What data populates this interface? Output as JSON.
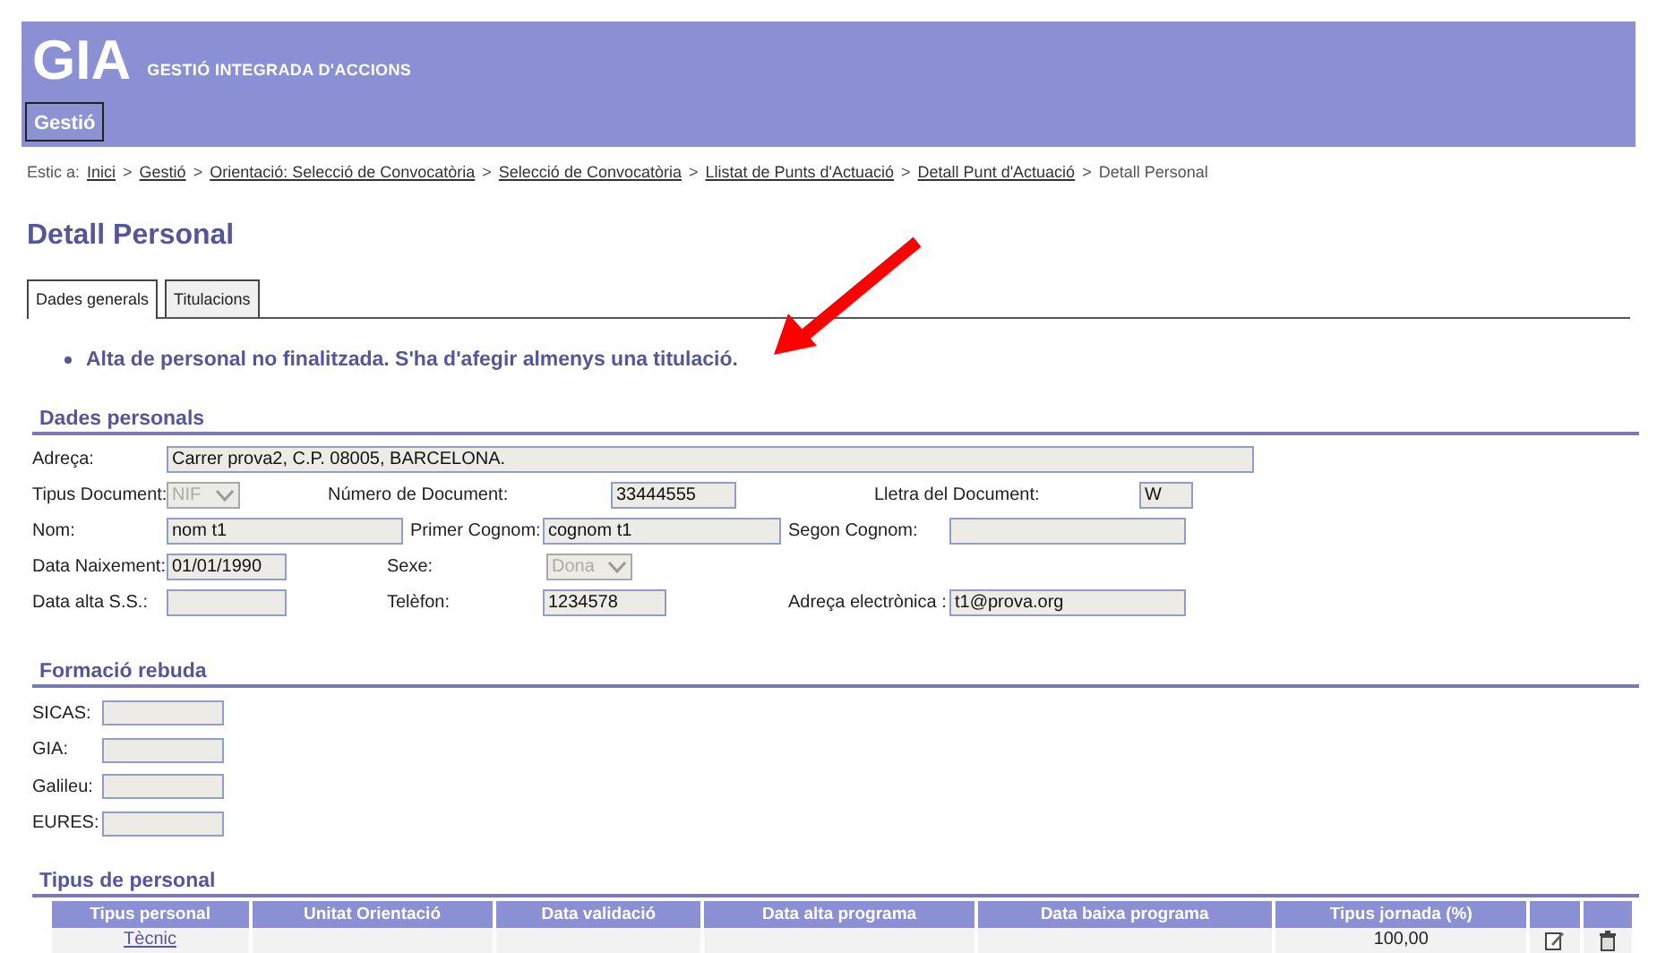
{
  "header": {
    "logo": "GIA",
    "subtitle": "GESTIÓ INTEGRADA D'ACCIONS",
    "menu": [
      {
        "label": "Gestió",
        "selected": true
      }
    ]
  },
  "breadcrumb": {
    "prefix": "Estic a:",
    "items": [
      {
        "label": "Inici",
        "link": true
      },
      {
        "label": "Gestió",
        "link": true
      },
      {
        "label": "Orientació: Selecció de Convocatòria",
        "link": true
      },
      {
        "label": "Selecció de Convocatòria",
        "link": true
      },
      {
        "label": "Llistat de Punts d'Actuació",
        "link": true
      },
      {
        "label": "Detall Punt d'Actuació",
        "link": true
      },
      {
        "label": "Detall Personal",
        "link": false
      }
    ],
    "separator": ">"
  },
  "title": "Detall Personal",
  "tabs": [
    {
      "label": "Dades generals",
      "selected": true
    },
    {
      "label": "Titulacions",
      "selected": false
    }
  ],
  "messages": [
    "Alta de personal no finalitzada. S'ha d'afegir almenys una titulació."
  ],
  "dades_personals": {
    "title": "Dades personals",
    "rows": [
      [
        {
          "label": "Adreça:",
          "kind": "text",
          "value": "Carrer prova2, C.P. 08005, BARCELONA."
        }
      ],
      [
        {
          "label": "Tipus Document:",
          "kind": "select",
          "value": "NIF",
          "disabled": true
        },
        {
          "label": "Número de Document:",
          "kind": "text",
          "value": "33444555"
        },
        {
          "label": "Lletra del Document:",
          "kind": "text",
          "value": "W"
        }
      ],
      [
        {
          "label": "Nom:",
          "kind": "text",
          "value": "nom t1"
        },
        {
          "label": "Primer Cognom:",
          "kind": "text",
          "value": "cognom t1"
        },
        {
          "label": "Segon Cognom:",
          "kind": "text"
        }
      ],
      [
        {
          "label": "Data Naixement:",
          "kind": "text",
          "value": "01/01/1990"
        },
        {
          "label": "Sexe:",
          "kind": "select",
          "value": "Dona",
          "disabled": true
        }
      ],
      [
        {
          "label": "Data alta S.S.:",
          "kind": "text"
        },
        {
          "label": "Telèfon:",
          "kind": "text",
          "value": "1234578"
        },
        {
          "label": "Adreça electrònica :",
          "kind": "text",
          "value": "t1@prova.org"
        }
      ]
    ]
  },
  "formacio_rebuda": {
    "title": "Formació rebuda",
    "fields": [
      {
        "label": "SICAS:"
      },
      {
        "label": "GIA:"
      },
      {
        "label": "Galileu:"
      },
      {
        "label": "EURES:"
      }
    ]
  },
  "tipus_personal": {
    "title": "Tipus de personal",
    "columns": [
      "Tipus personal",
      "Unitat Orientació",
      "Data validació",
      "Data alta programa",
      "Data baixa programa",
      "Tipus jornada (%)"
    ],
    "rows": [
      {
        "cells": {
          "0": "Tècnic",
          "5": "100,00"
        }
      }
    ]
  }
}
